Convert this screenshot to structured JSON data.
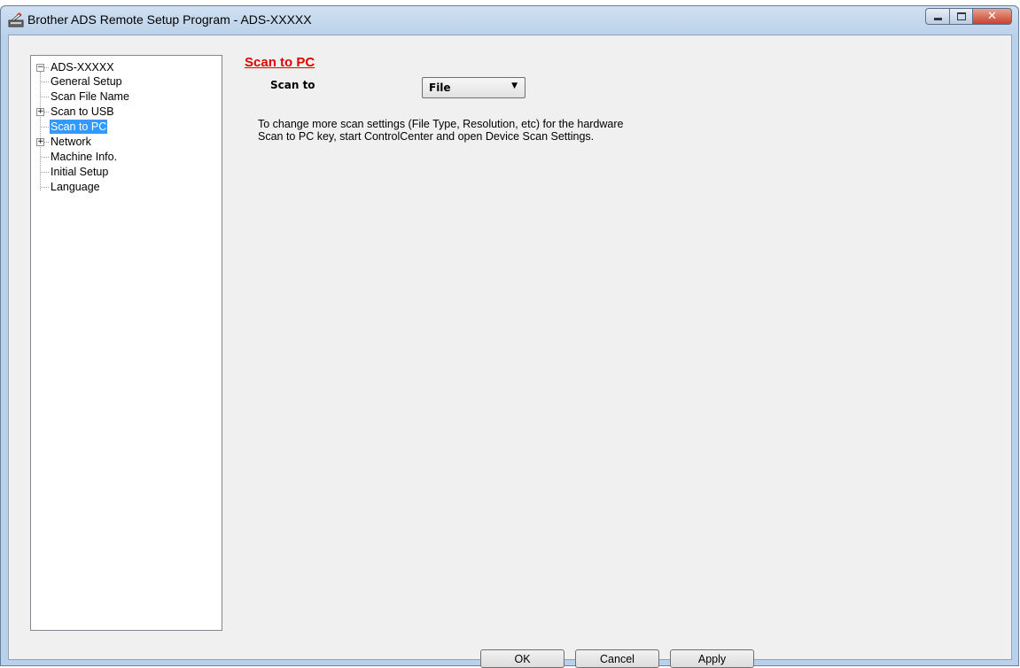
{
  "window": {
    "title": "Brother ADS Remote Setup Program - ADS-XXXXX",
    "app_icon": "scanner-icon",
    "caption_icons": [
      "minimize-icon",
      "maximize-icon",
      "close-icon"
    ]
  },
  "tree": {
    "root": "ADS-XXXXX",
    "items": [
      {
        "label": "General Setup",
        "expandable": false
      },
      {
        "label": "Scan File Name",
        "expandable": false
      },
      {
        "label": "Scan to USB",
        "expandable": true
      },
      {
        "label": "Scan to PC",
        "expandable": false,
        "selected": true
      },
      {
        "label": "Network",
        "expandable": true
      },
      {
        "label": "Machine Info.",
        "expandable": false
      },
      {
        "label": "Initial Setup",
        "expandable": false
      },
      {
        "label": "Language",
        "expandable": false
      }
    ]
  },
  "panel": {
    "title": "Scan to PC",
    "scan_to_label": "Scan to",
    "scan_to_value": "File",
    "description_line1": "To change more scan settings (File Type, Resolution, etc) for the hardware",
    "description_line2": "Scan to PC key, start ControlCenter and open Device Scan Settings."
  },
  "buttons": {
    "ok": "OK",
    "cancel": "Cancel",
    "apply": "Apply"
  },
  "colors": {
    "section_title": "#e00000",
    "selection": "#3399ff",
    "window_frame": "#b9d1ea"
  }
}
